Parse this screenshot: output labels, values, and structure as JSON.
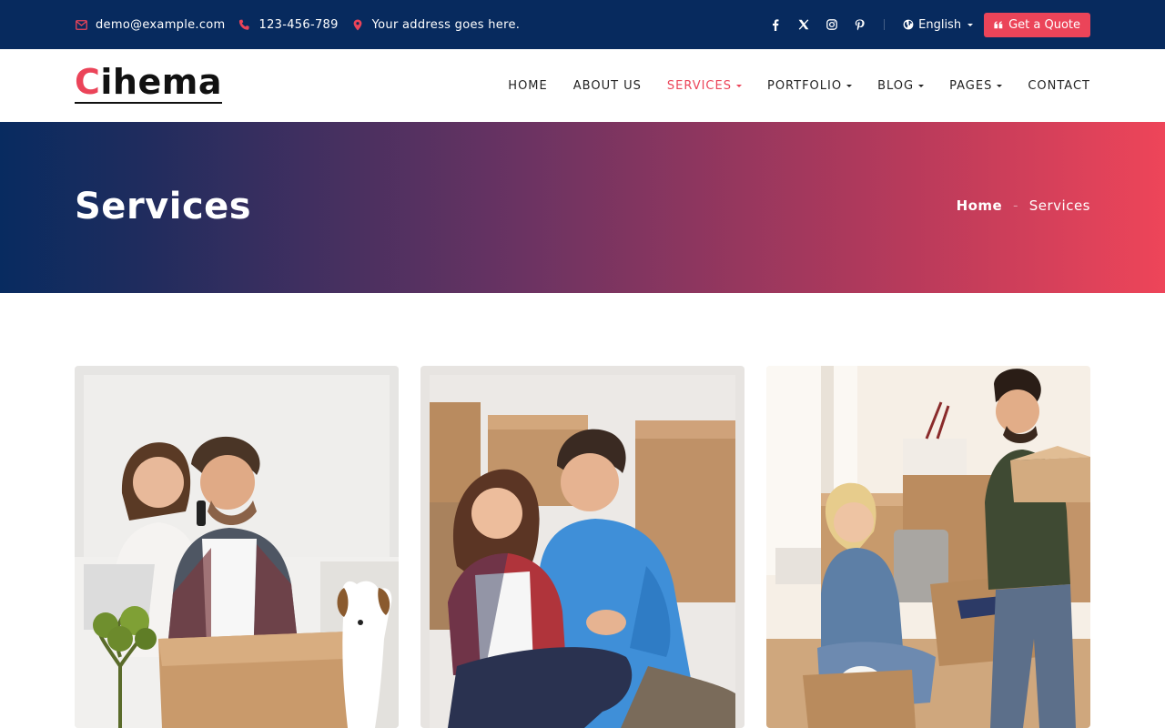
{
  "topbar": {
    "email": "demo@example.com",
    "phone": "123-456-789",
    "address": "Your address goes here.",
    "social_icons": [
      "facebook-icon",
      "x-icon",
      "instagram-icon",
      "pinterest-icon"
    ],
    "language": "English",
    "quote_label": "Get a Quote"
  },
  "logo": {
    "first": "C",
    "rest": "ihema"
  },
  "nav": {
    "items": [
      {
        "label": "HOME",
        "dropdown": false
      },
      {
        "label": "ABOUT US",
        "dropdown": false
      },
      {
        "label": "SERVICES",
        "dropdown": true,
        "active": true
      },
      {
        "label": "PORTFOLIO",
        "dropdown": true
      },
      {
        "label": "BLOG",
        "dropdown": true
      },
      {
        "label": "PAGES",
        "dropdown": true
      },
      {
        "label": "CONTACT",
        "dropdown": false
      }
    ]
  },
  "hero": {
    "title": "Services",
    "breadcrumb": {
      "home": "Home",
      "current": "Services"
    }
  },
  "cards": [
    {
      "image": "couple-on-phone-with-laptop-and-dog"
    },
    {
      "image": "couple-sitting-among-boxes"
    },
    {
      "image": "couple-unpacking-moving-boxes"
    }
  ],
  "colors": {
    "topbar": "#072a5e",
    "accent": "#eb4459",
    "hero_start": "#082b60",
    "hero_end": "#ee4559"
  }
}
